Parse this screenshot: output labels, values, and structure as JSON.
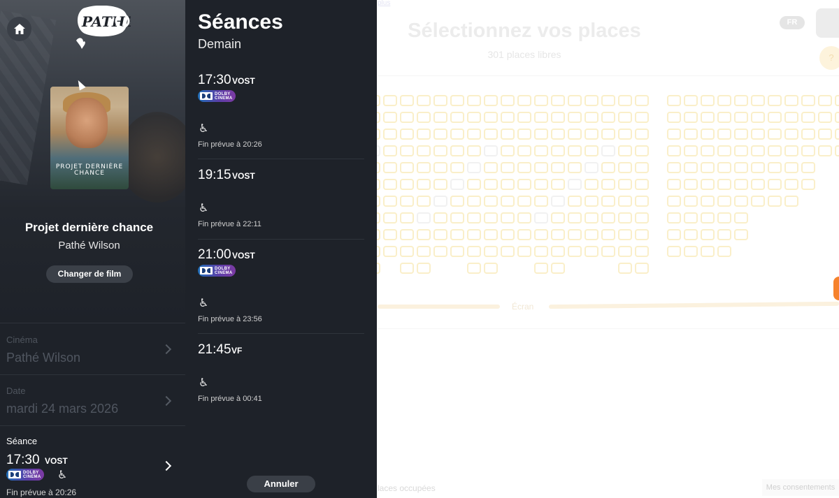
{
  "background": {
    "top_link": "plus",
    "title": "Sélectionnez vos places",
    "free_places": "301 places libres",
    "lang": "FR",
    "help": "?",
    "screen_label": "Écran",
    "occupied_legend": "laces occupées",
    "consent": "Mes consentements"
  },
  "left": {
    "logo_text": "PATHÉ",
    "film": {
      "title": "Projet dernière chance",
      "cinema": "Pathé Wilson",
      "poster_text": "PROJET DERNIÈRE CHANCE"
    },
    "change_film_label": "Changer de film",
    "steps": {
      "cinema": {
        "label": "Cinéma",
        "value": "Pathé Wilson"
      },
      "date": {
        "label": "Date",
        "value": "mardi 24 mars 2026"
      },
      "seance": {
        "label": "Séance",
        "time": "17:30",
        "version": "VOST",
        "end": "Fin prévue à 20:26"
      }
    }
  },
  "seances": {
    "title": "Séances",
    "day": "Demain",
    "items": [
      {
        "time": "17:30",
        "version": "VOST",
        "dolby": true,
        "end": "Fin prévue à 20:26"
      },
      {
        "time": "19:15",
        "version": "VOST",
        "dolby": false,
        "end": "Fin prévue à 22:11"
      },
      {
        "time": "21:00",
        "version": "VOST",
        "dolby": true,
        "end": "Fin prévue à 23:56"
      },
      {
        "time": "21:45",
        "version": "VF",
        "dolby": false,
        "end": "Fin prévue à 00:41"
      }
    ],
    "cancel_label": "Annuler"
  },
  "badges": {
    "dolby_line1": "DOLBY",
    "dolby_line2": "CINEMA",
    "wheelchair_icon": "wheelchair-icon"
  },
  "colors": {
    "panel": "#1e2229",
    "seat": "#faefc9",
    "accent": "#f6822c"
  }
}
